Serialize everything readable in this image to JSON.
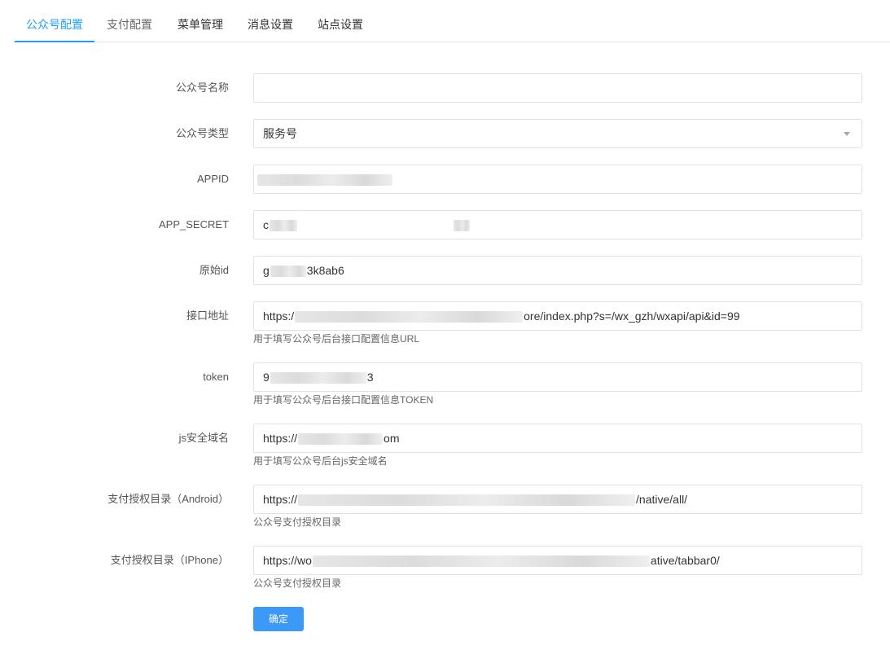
{
  "tabs": [
    {
      "label": "公众号配置"
    },
    {
      "label": "支付配置"
    },
    {
      "label": "菜单管理"
    },
    {
      "label": "消息设置"
    },
    {
      "label": "站点设置"
    }
  ],
  "form": {
    "name": {
      "label": "公众号名称",
      "value": ""
    },
    "type": {
      "label": "公众号类型",
      "value": "服务号"
    },
    "appid": {
      "label": "APPID"
    },
    "secret": {
      "label": "APP_SECRET",
      "value_prefix": "c"
    },
    "origin": {
      "label": "原始id",
      "value_prefix": "g",
      "value_mid": "3k",
      "value_suffix": "8ab6"
    },
    "api": {
      "label": "接口地址",
      "value_prefix": "https:/",
      "value_suffix": "ore/index.php?s=/wx_gzh/wxapi/api&id=99",
      "help": "用于填写公众号后台接口配置信息URL"
    },
    "token": {
      "label": "token",
      "value_prefix": "9",
      "value_suffix": "3",
      "help": "用于填写公众号后台接口配置信息TOKEN"
    },
    "jsdomain": {
      "label": "js安全域名",
      "value_prefix": "https://",
      "value_suffix": "om",
      "help": "用于填写公众号后台js安全域名"
    },
    "pay_android": {
      "label": "支付授权目录（Android）",
      "value_prefix": "https://",
      "value_suffix": "/native/all/",
      "help": "公众号支付授权目录"
    },
    "pay_iphone": {
      "label": "支付授权目录（IPhone）",
      "value_prefix": "https://wo",
      "value_suffix": "ative/tabbar0/",
      "help": "公众号支付授权目录"
    }
  },
  "submit_label": "确定"
}
